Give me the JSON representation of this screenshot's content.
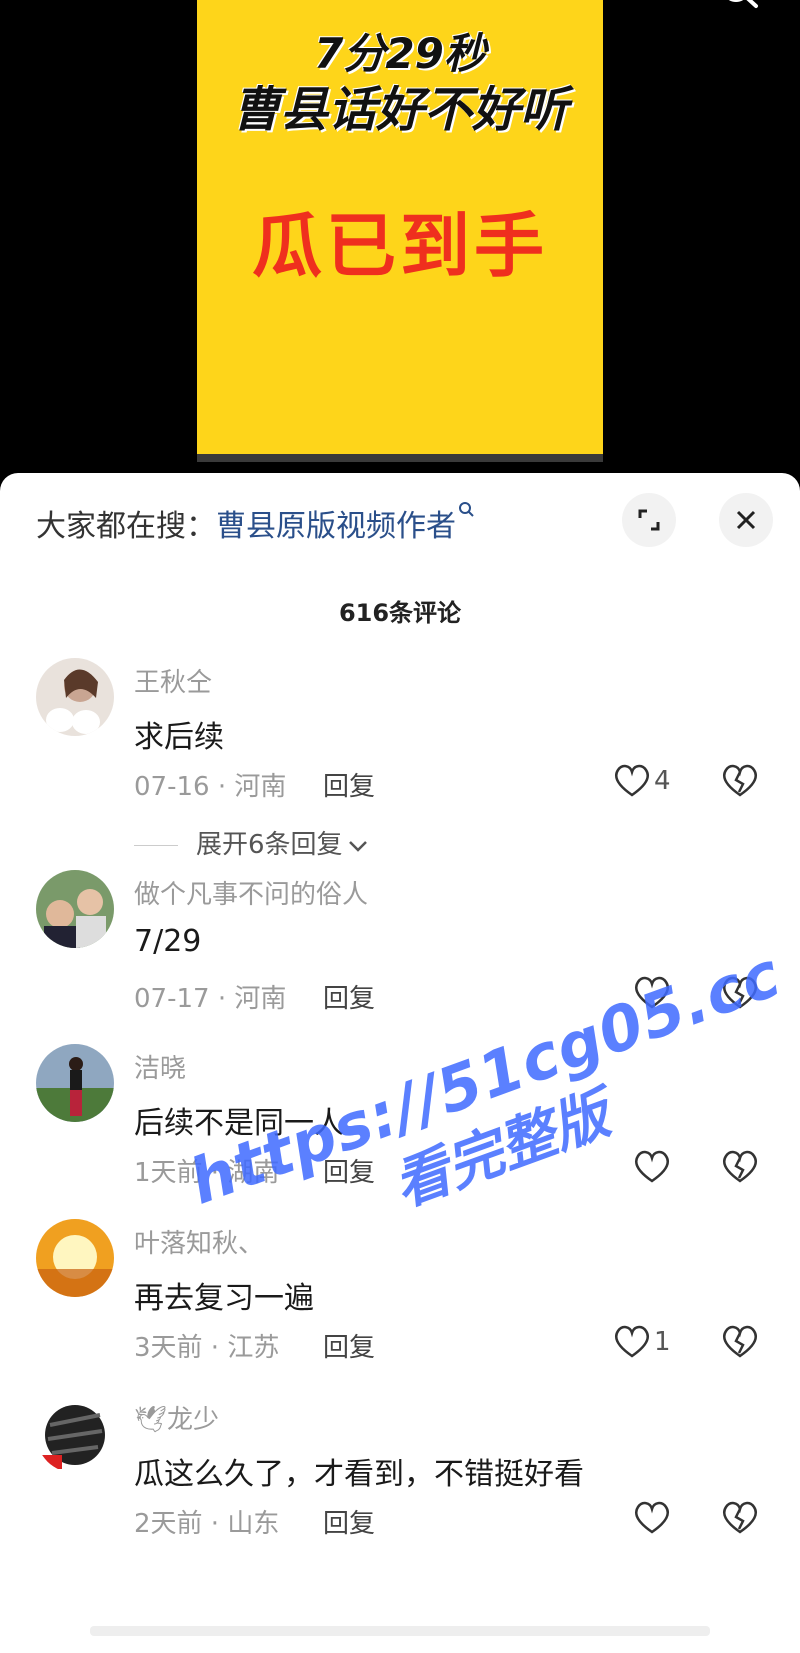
{
  "video": {
    "title_line1": "7分29秒",
    "title_line2": "曹县话好不好听",
    "subtitle": "瓜已到手",
    "bg_color": "#fed51a",
    "accent_color": "#ef2f1e"
  },
  "panel": {
    "suggest_prefix": "大家都在搜：",
    "suggest_link": "曹县原版视频作者",
    "comment_count": "616条评论"
  },
  "comments": [
    {
      "user": "王秋仝",
      "text": "求后续",
      "meta": "07-16 · 河南",
      "reply": "回复",
      "likes": "4",
      "more": "展开6条回复"
    },
    {
      "user": "做个凡事不问的俗人",
      "text": "7/29",
      "meta": "07-17 · 河南",
      "reply": "回复",
      "likes": ""
    },
    {
      "user": "洁晓",
      "text": "后续不是同一人",
      "meta": "1天前 · 湖南",
      "reply": "回复",
      "likes": ""
    },
    {
      "user": "叶落知秋、",
      "text": "再去复习一遍",
      "meta": "3天前 · 江苏",
      "reply": "回复",
      "likes": "1"
    },
    {
      "user": "龙少",
      "text": "瓜这么久了，才看到，不错挺好看",
      "meta": "2天前 · 山东",
      "reply": "回复",
      "likes": ""
    }
  ],
  "watermark": {
    "line1": "https://51cg05.cc",
    "line2": "看完整版"
  },
  "icons": [
    "search-icon",
    "expand-icon",
    "close-icon",
    "heart-icon",
    "broken-heart-icon",
    "chevron-down-icon"
  ]
}
